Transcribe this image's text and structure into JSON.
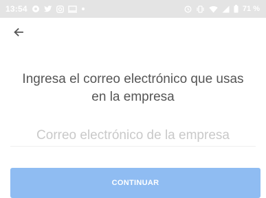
{
  "status_bar": {
    "time": "13:54",
    "battery_percent": "71 %",
    "left_icons": [
      "message-icon",
      "twitter-icon",
      "instagram-icon",
      "screen-icon",
      "dot-icon"
    ],
    "right_icons": [
      "alarm-icon",
      "vibrate-icon",
      "wifi-icon",
      "signal-icon",
      "battery-icon"
    ]
  },
  "header": {
    "back_icon": "arrow-left-icon"
  },
  "main": {
    "headline": "Ingresa el correo electrónico que usas en la empresa",
    "email_placeholder": "Correo electrónico de la empresa",
    "email_value": "",
    "continue_label": "CONTINUAR"
  },
  "colors": {
    "status_bar_bg": "#e4e4e4",
    "button_bg": "#8fbcf2",
    "headline_text": "#555555",
    "placeholder_text": "#c9c9c9"
  }
}
